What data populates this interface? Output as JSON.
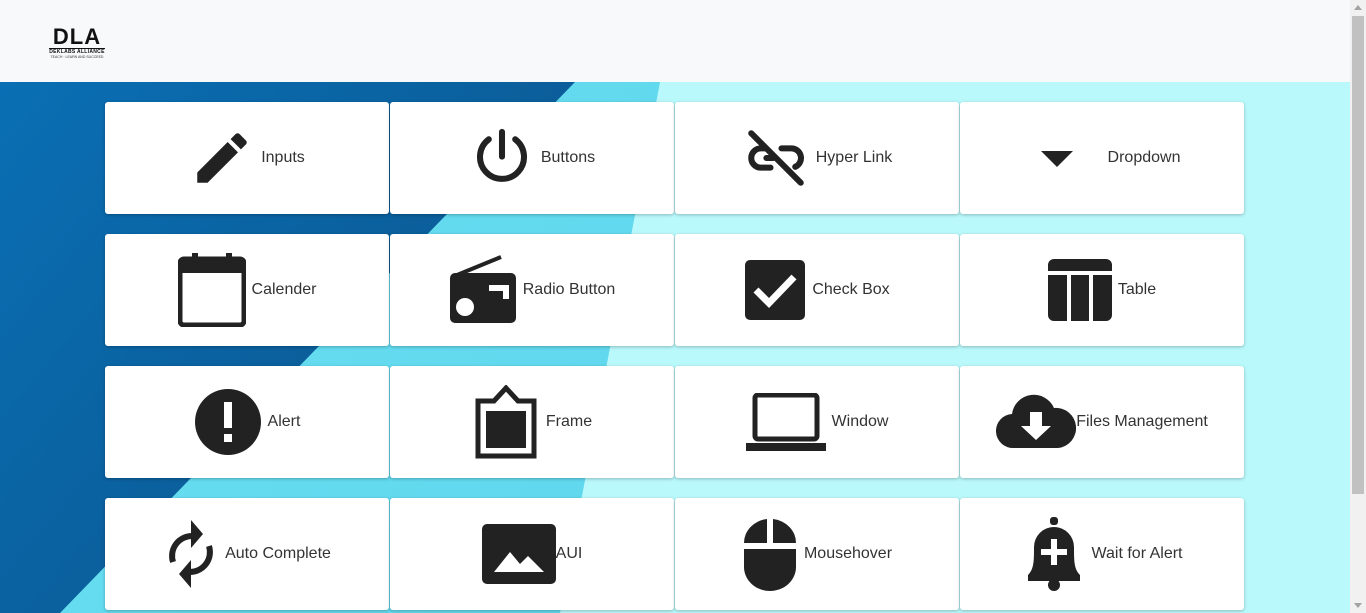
{
  "logo": {
    "text": "DLA",
    "subtitle": "DEKLABS ALLIANCE",
    "tagline": "TEACH · LEARN AND SUCCEED"
  },
  "cards": [
    {
      "label": "Inputs",
      "icon": "pencil-icon"
    },
    {
      "label": "Buttons",
      "icon": "power-icon"
    },
    {
      "label": "Hyper Link",
      "icon": "link-off-icon"
    },
    {
      "label": "Dropdown",
      "icon": "arrow-drop-down-icon"
    },
    {
      "label": "Calender",
      "icon": "calendar-icon"
    },
    {
      "label": "Radio Button",
      "icon": "radio-icon"
    },
    {
      "label": "Check Box",
      "icon": "check-box-icon"
    },
    {
      "label": "Table",
      "icon": "table-icon"
    },
    {
      "label": "Alert",
      "icon": "alert-circle-icon"
    },
    {
      "label": "Frame",
      "icon": "frame-icon"
    },
    {
      "label": "Window",
      "icon": "laptop-icon"
    },
    {
      "label": "Files Management",
      "icon": "cloud-download-icon"
    },
    {
      "label": "Auto Complete",
      "icon": "refresh-icon"
    },
    {
      "label": "AUI",
      "icon": "image-icon"
    },
    {
      "label": "Mousehover",
      "icon": "mouse-icon"
    },
    {
      "label": "Wait for Alert",
      "icon": "bell-plus-icon"
    }
  ]
}
